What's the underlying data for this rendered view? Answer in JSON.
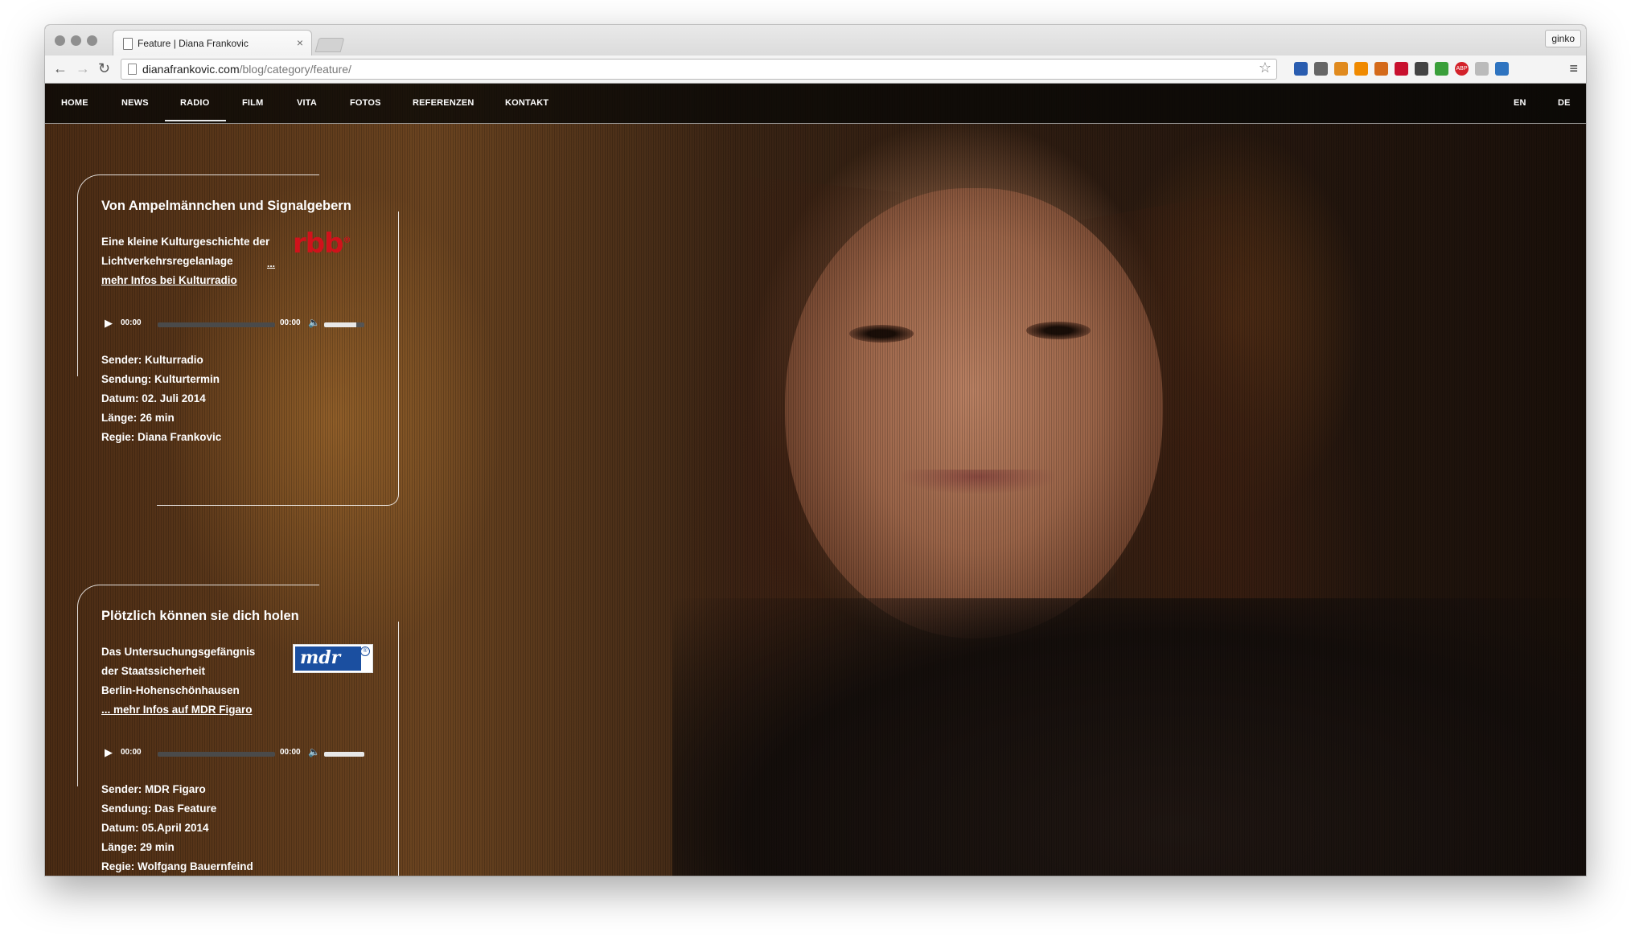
{
  "browser": {
    "tab_title": "Feature | Diana Frankovic",
    "tab_close": "×",
    "profile": "ginko",
    "url_host": "dianafrankovic.com",
    "url_path": "/blog/category/feature/",
    "back_icon": "←",
    "forward_icon": "→",
    "reload_icon": "↻",
    "star_icon": "☆",
    "menu_icon": "≡",
    "extensions": [
      {
        "name": "dropbox-ext-icon",
        "color": "#2a5db0"
      },
      {
        "name": "eyedropper-ext-icon",
        "color": "#666666"
      },
      {
        "name": "rss-ext-icon",
        "color": "#e08a1e"
      },
      {
        "name": "chart-ext-icon",
        "color": "#f08a00"
      },
      {
        "name": "owl-ext-icon",
        "color": "#d46a1a"
      },
      {
        "name": "lastpass-ext-icon",
        "color": "#c8102e"
      },
      {
        "name": "bookmark-star-ext-icon",
        "color": "#444444"
      },
      {
        "name": "colorzilla-ext-icon",
        "color": "#3a9f3a"
      },
      {
        "name": "adblock-ext-icon",
        "color": "#d3222a",
        "label": "ABP"
      },
      {
        "name": "grey-ext-icon",
        "color": "#bbbbbb"
      },
      {
        "name": "share-ext-icon",
        "color": "#2f74c0"
      }
    ]
  },
  "nav": {
    "items": [
      "HOME",
      "NEWS",
      "RADIO",
      "FILM",
      "VITA",
      "FOTOS",
      "REFERENZEN",
      "KONTAKT"
    ],
    "active": "RADIO",
    "lang": [
      "EN",
      "DE"
    ]
  },
  "posts": [
    {
      "title": "Von Ampelmännchen und Signalgebern",
      "desc": [
        "Eine kleine Kulturgeschichte der",
        "Lichtverkehrsregelanlage"
      ],
      "ellipsis": "...",
      "link": "mehr Infos bei Kulturradio",
      "logo": "rbb",
      "player": {
        "current": "00:00",
        "duration": "00:00",
        "volume": 0.8,
        "play_icon": "▶",
        "volume_icon": "🔈"
      },
      "info": [
        "Sender: Kulturradio",
        "Sendung: Kulturtermin",
        "Datum: 02. Juli 2014",
        "Länge: 26 min",
        "Regie: Diana Frankovic"
      ]
    },
    {
      "title": "Plötzlich können sie dich holen",
      "desc": [
        "Das Untersuchungsgefängnis",
        "der Staatssicherheit",
        "Berlin-Hohenschönhausen"
      ],
      "link": "... mehr Infos auf MDR Figaro",
      "logo": "mdr",
      "player": {
        "current": "00:00",
        "duration": "00:00",
        "volume": 1.0,
        "play_icon": "▶",
        "volume_icon": "🔈"
      },
      "info": [
        "Sender: MDR Figaro",
        "Sendung: Das Feature",
        "Datum: 05.April 2014",
        "Länge: 29 min",
        "Regie: Wolfgang Bauernfeind"
      ]
    }
  ]
}
